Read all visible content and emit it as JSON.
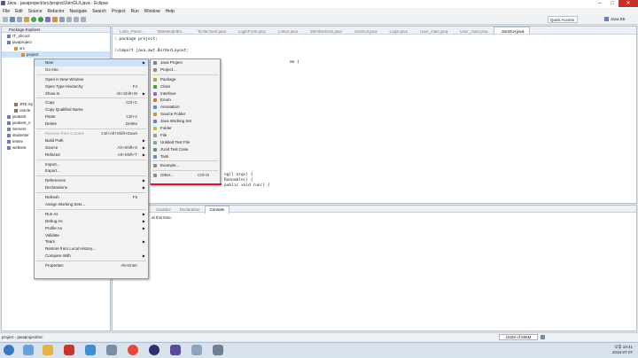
{
  "window": {
    "title": "Java - javaproject/src/project/JoinGUI.java - Eclipse"
  },
  "menubar": [
    "File",
    "Edit",
    "Source",
    "Refactor",
    "Navigate",
    "Search",
    "Project",
    "Run",
    "Window",
    "Help"
  ],
  "toolbar": {
    "quick_access": "Quick Access",
    "perspective": "Java EE"
  },
  "explorer": {
    "title": "Package Explorer",
    "rows": [
      {
        "label": "IT_shcool",
        "depth": 0
      },
      {
        "label": "javaproject",
        "depth": 0
      },
      {
        "label": "src",
        "depth": 1
      },
      {
        "label": "project",
        "depth": 2
      },
      {
        "label": "JRE Sy",
        "depth": 1
      },
      {
        "label": "oracle",
        "depth": 1
      },
      {
        "label": "javatest",
        "depth": 0
      },
      {
        "label": "javatest_n",
        "depth": 0
      },
      {
        "label": "Servers",
        "depth": 0
      },
      {
        "label": "studenter",
        "depth": 0
      },
      {
        "label": "testev",
        "depth": 0
      },
      {
        "label": "webtest",
        "depth": 0
      }
    ]
  },
  "editor": {
    "tabs": [
      "Lotto_Panel...",
      "TableModelEx...",
      "TicTacToe2.java",
      "LoginFrom.java",
      "Lotto2.java",
      "MemberDAO.java",
      "JoinGUI.java",
      "Login.java",
      "User_main.java",
      "User_main.java",
      "JoinGUI.java"
    ],
    "active_tab": "JoinGUI.java",
    "lines": [
      "package project;",
      "import java.awt.BorderLayout;"
    ],
    "frag_a": "me {",
    "frag_b": "ng[] args) {",
    "frag_c": "Runnable() {",
    "frag_d": "public void run() {"
  },
  "console": {
    "tabs": [
      "Javadoc",
      "Declaration",
      "Console"
    ],
    "active": "Console",
    "text": "at this time."
  },
  "context_menu": {
    "items": [
      {
        "label": "New",
        "acc": "",
        "sub": true,
        "hl": true
      },
      {
        "label": "Go Into",
        "acc": ""
      },
      {
        "sep": true
      },
      {
        "label": "Open in New Window",
        "acc": ""
      },
      {
        "label": "Open Type Hierarchy",
        "acc": "F4"
      },
      {
        "label": "Show In",
        "acc": "Alt+Shift+W",
        "sub": true
      },
      {
        "sep": true
      },
      {
        "label": "Copy",
        "acc": "Ctrl+C"
      },
      {
        "label": "Copy Qualified Name",
        "acc": ""
      },
      {
        "label": "Paste",
        "acc": "Ctrl+V"
      },
      {
        "label": "Delete",
        "acc": "Delete"
      },
      {
        "sep": true
      },
      {
        "label": "Remove from Context",
        "acc": "Ctrl+Alt+Shift+Down",
        "dis": true
      },
      {
        "label": "Build Path",
        "acc": "",
        "sub": true
      },
      {
        "label": "Source",
        "acc": "Alt+Shift+S",
        "sub": true
      },
      {
        "label": "Refactor",
        "acc": "Alt+Shift+T",
        "sub": true
      },
      {
        "sep": true
      },
      {
        "label": "Import...",
        "acc": ""
      },
      {
        "label": "Export...",
        "acc": ""
      },
      {
        "sep": true
      },
      {
        "label": "References",
        "acc": "",
        "sub": true
      },
      {
        "label": "Declarations",
        "acc": "",
        "sub": true
      },
      {
        "sep": true
      },
      {
        "label": "Refresh",
        "acc": "F5"
      },
      {
        "label": "Assign Working Sets...",
        "acc": ""
      },
      {
        "sep": true
      },
      {
        "label": "Run As",
        "acc": "",
        "sub": true
      },
      {
        "label": "Debug As",
        "acc": "",
        "sub": true
      },
      {
        "label": "Profile As",
        "acc": "",
        "sub": true
      },
      {
        "label": "Validate",
        "acc": ""
      },
      {
        "label": "Team",
        "acc": "",
        "sub": true
      },
      {
        "label": "Restore from Local History...",
        "acc": ""
      },
      {
        "label": "Compare With",
        "acc": "",
        "sub": true
      },
      {
        "sep": true
      },
      {
        "label": "Properties",
        "acc": "Alt+Enter"
      }
    ]
  },
  "submenu": {
    "items": [
      {
        "label": "Java Project",
        "acc": "",
        "color": "#6a7fb8"
      },
      {
        "label": "Project...",
        "acc": "",
        "color": "#8a8a8a"
      },
      {
        "sep": true
      },
      {
        "label": "Package",
        "acc": "",
        "color": "#c49a3a"
      },
      {
        "label": "Class",
        "acc": "",
        "color": "#3f9a4b"
      },
      {
        "label": "Interface",
        "acc": "",
        "color": "#8a6cc4"
      },
      {
        "label": "Enum",
        "acc": "",
        "color": "#b0853a"
      },
      {
        "label": "Annotation",
        "acc": "",
        "color": "#5c8fbf"
      },
      {
        "label": "Source Folder",
        "acc": "",
        "color": "#c49a3a"
      },
      {
        "label": "Java Working Set",
        "acc": "",
        "color": "#6a7fb8"
      },
      {
        "label": "Folder",
        "acc": "",
        "color": "#d7b04a"
      },
      {
        "label": "File",
        "acc": "",
        "color": "#9a9a9a"
      },
      {
        "label": "Untitled Text File",
        "acc": "",
        "color": "#9a9a9a"
      },
      {
        "label": "JUnit Test Case",
        "acc": "",
        "color": "#4aa35a"
      },
      {
        "label": "Task",
        "acc": "",
        "color": "#5c8fbf"
      },
      {
        "sep": true
      },
      {
        "label": "Example...",
        "acc": "",
        "color": "#8a8a8a"
      },
      {
        "sep": true
      },
      {
        "label": "Other...",
        "acc": "Ctrl+N",
        "color": "#8a8a8a"
      }
    ]
  },
  "status": {
    "path": "project - javaproject/src",
    "heap": "182M of 665M"
  },
  "clock": {
    "time": "오후 10:41",
    "date": "2016-07-07"
  }
}
